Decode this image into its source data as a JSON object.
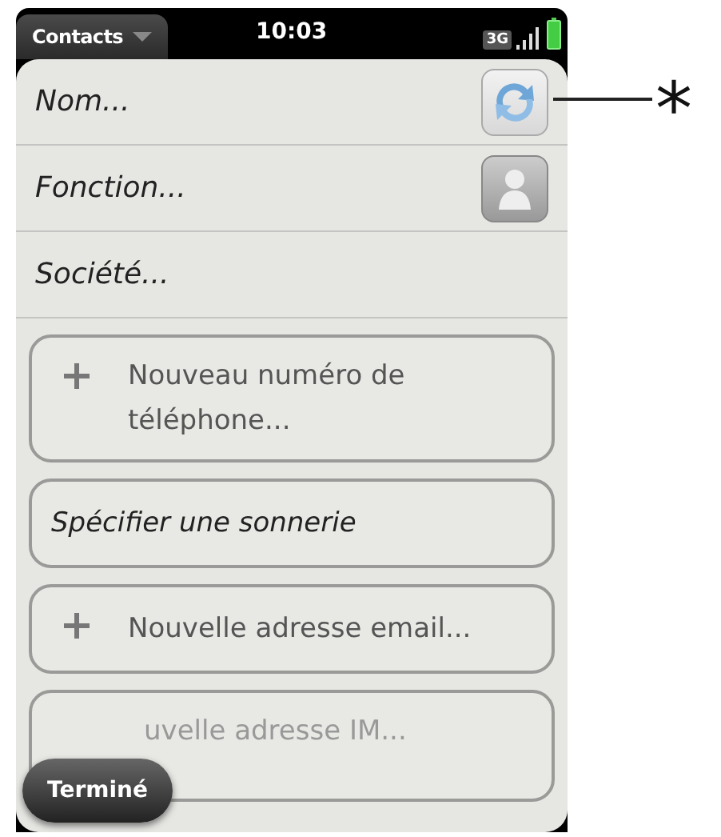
{
  "status_bar": {
    "app_menu": "Contacts",
    "time": "10:03",
    "network": "3G"
  },
  "fields": [
    {
      "placeholder": "Nom...",
      "kind": "sync"
    },
    {
      "placeholder": "Fonction...",
      "kind": "person"
    },
    {
      "placeholder": "Société...",
      "kind": "plain"
    }
  ],
  "actions": [
    {
      "kind": "add",
      "label": "Nouveau numéro de téléphone..."
    },
    {
      "kind": "plain",
      "label": "Spécifier une sonnerie"
    },
    {
      "kind": "add",
      "label": "Nouvelle adresse email..."
    },
    {
      "kind": "covered",
      "label": "uvelle adresse IM..."
    }
  ],
  "done_button": "Terminé",
  "annotation": "*"
}
